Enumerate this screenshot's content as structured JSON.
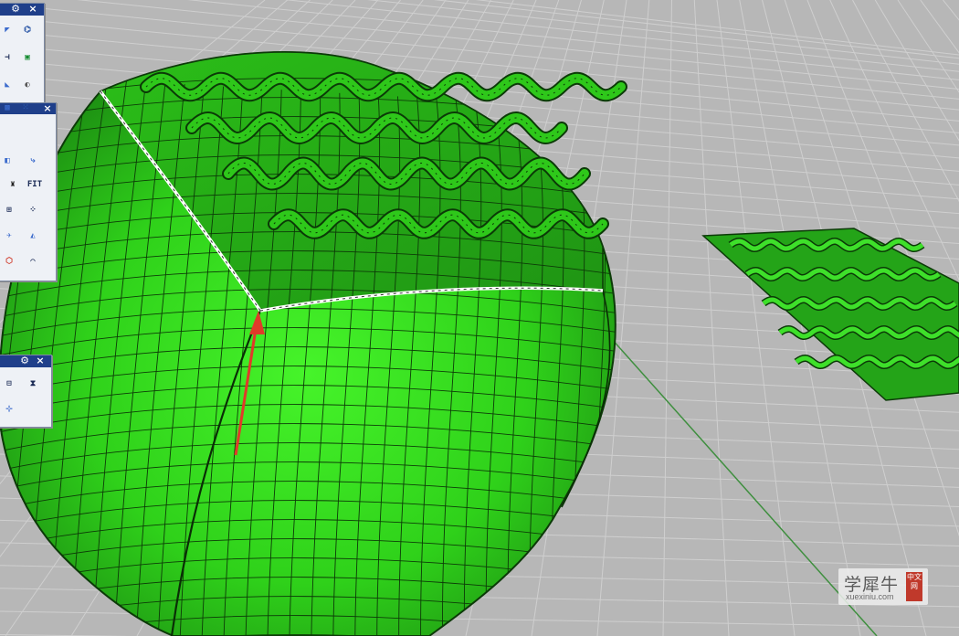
{
  "viewport": {
    "background": "#b7b7b7",
    "grid_color": "#cfcfcf",
    "axis_color": "#3f8f3f",
    "surface_color": "#33dd1a",
    "surface_dark": "#1e8a14",
    "arrow_color": "#e03a2a"
  },
  "palettes": [
    {
      "name": "top-palette",
      "tools": [
        "flow-icon",
        "ring-icon",
        "split-icon",
        "render-icon",
        "sweep-icon",
        "sphere-icon",
        "texture-icon",
        "point-grid-icon"
      ]
    },
    {
      "name": "middle-palette",
      "fit_label": "FIT",
      "tools": [
        "mirror-icon",
        "arrow-flow-icon",
        "figure-icon",
        "fit-icon",
        "snap-icon",
        "dots-icon",
        "satellite-icon",
        "paint-icon",
        "box-icon",
        "curve-icon"
      ]
    },
    {
      "name": "bottom-palette",
      "tools": [
        "columns-icon",
        "hourglass-icon",
        "node-icon"
      ]
    }
  ],
  "watermark": {
    "chinese_text": "学犀牛",
    "domain": "xuexiniu.com",
    "seal_text": "中文网"
  }
}
